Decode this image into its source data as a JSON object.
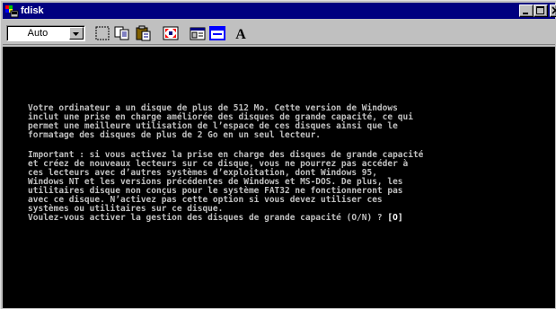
{
  "window": {
    "title": "fdisk",
    "icon": "ms-dos-icon",
    "controls": [
      "minimize-icon",
      "maximize-icon",
      "close-icon"
    ]
  },
  "toolbar": {
    "font_size_value": "Auto",
    "buttons": [
      {
        "name": "mark-icon"
      },
      {
        "name": "copy-icon"
      },
      {
        "name": "paste-icon"
      },
      {
        "name": "full-screen-icon"
      },
      {
        "name": "properties-icon"
      },
      {
        "name": "background-icon"
      },
      {
        "name": "font-icon"
      }
    ],
    "font_button_glyph": "A"
  },
  "console": {
    "paragraph1": [
      "Votre ordinateur a un disque de plus de 512 Mo. Cette version de Windows",
      "inclut une prise en charge améliorée des disques de grande capacité, ce qui",
      "permet une meilleure utilisation de l’espace de ces disques ainsi que le",
      "formatage des disques de plus de 2 Go en un seul lecteur."
    ],
    "paragraph2": [
      "Important : si vous activez la prise en charge des disques de grande capacité",
      "et créez de nouveaux lecteurs sur ce disque, vous ne pourrez pas accéder à",
      "ces lecteurs avec d’autres systèmes d’exploitation, dont Windows 95,",
      "Windows NT et les versions précédentes de Windows et MS-DOS. De plus, les",
      "utilitaires disque non conçus pour le système FAT32 ne fonctionneront pas",
      "avec ce disque. N’activez pas cette option si vous devez utiliser ces",
      "systèmes ou utilitaires sur ce disque."
    ],
    "prompt": "Voulez-vous activer la gestion des disques de grande capacité (O/N) ? ",
    "answer": "[O]"
  },
  "colors": {
    "title_bar": "#000080",
    "console_bg": "#000000",
    "console_text": "#c0c0c0",
    "face": "#c0c0c0"
  }
}
